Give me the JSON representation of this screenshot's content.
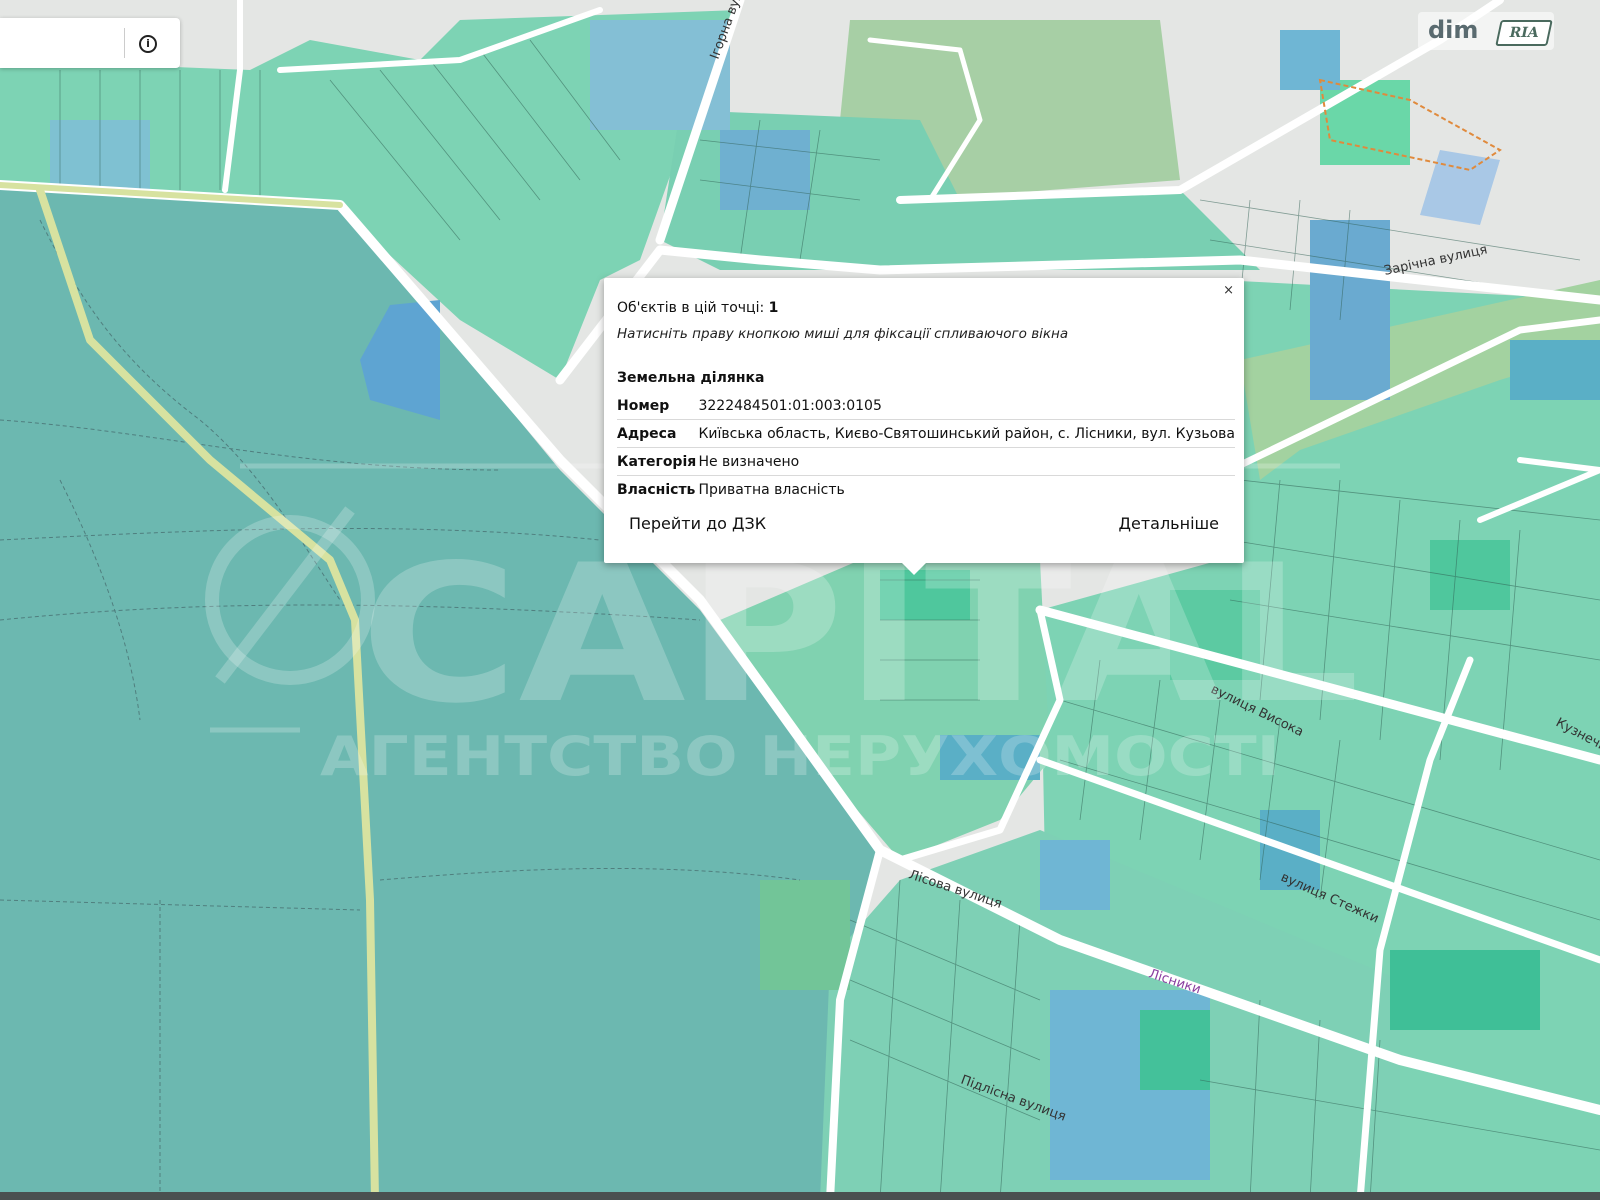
{
  "map": {
    "colors": {
      "forest": "#6cb8b0",
      "parcel": "#7dd3b4",
      "parcel_dark": "#4fc79d",
      "parcel_blue": "#6fb6d4",
      "road": "#ffffff",
      "green_area": "#a7d7a5"
    },
    "street_labels": [
      "Ігорна вулиця",
      "Зарічна вулиця",
      "Лісова вулиця",
      "вулиця Висока",
      "вулиця Стежки",
      "Лісники",
      "Підлісна вулиця",
      "Кузнечна"
    ],
    "watermark": {
      "brand": "CAPITAL",
      "tagline": "АГЕНТСТВО НЕРУХОМОСТІ"
    }
  },
  "search": {
    "info_icon": "info-icon",
    "info_glyph": "i"
  },
  "logo": {
    "dim": "dim",
    "ria": "RIA"
  },
  "popup": {
    "close_glyph": "×",
    "objects_label": "Об'єктів в цій точці:",
    "objects_count": "1",
    "hint": "Натисніть праву кнопкою миші для фіксації спливаючого вікна",
    "section_title": "Земельна ділянка",
    "rows": [
      {
        "key": "Номер",
        "value": "3222484501:01:003:0105"
      },
      {
        "key": "Адреса",
        "value": "Київська область, Києво-Святошинський район, с. Лісники, вул. Кузьова"
      },
      {
        "key": "Категорія",
        "value": "Не визначено"
      },
      {
        "key": "Власність",
        "value": "Приватна власність"
      }
    ],
    "action_left": "Перейти до ДЗК",
    "action_right": "Детальніше"
  }
}
